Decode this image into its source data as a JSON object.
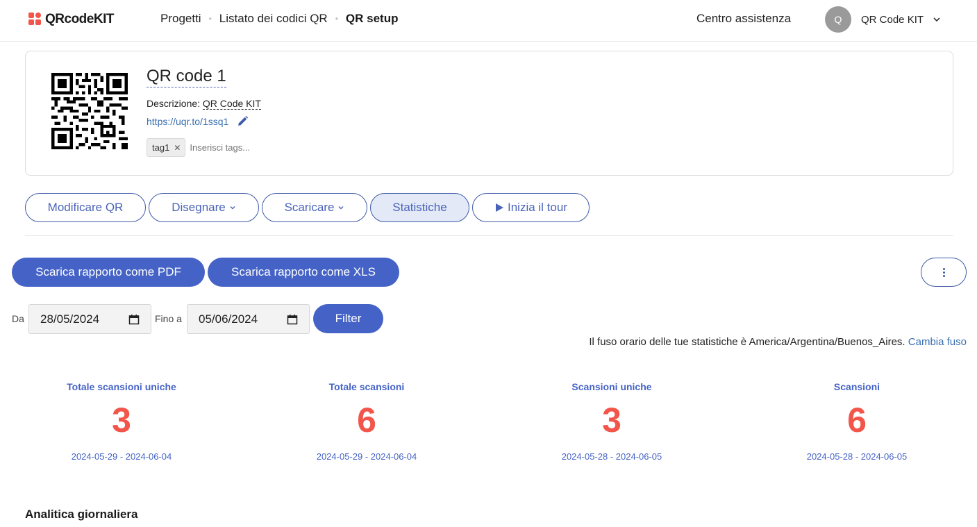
{
  "brand": {
    "name": "QRcodeKIT",
    "accent": "#4563c6",
    "logo_color": "#f2564b"
  },
  "breadcrumb": [
    {
      "label": "Progetti"
    },
    {
      "label": "Listato dei codici QR"
    },
    {
      "label": "QR setup"
    }
  ],
  "header": {
    "help_label": "Centro assistenza",
    "user_initial": "Q",
    "user_name": "QR Code KIT"
  },
  "qr": {
    "title": "QR code 1",
    "description_label": "Descrizione:",
    "description_value": "QR Code KIT",
    "url": "https://uqr.to/1ssq1",
    "tags": [
      "tag1"
    ],
    "tag_placeholder": "Inserisci tags..."
  },
  "tabs": [
    {
      "label": "Modificare QR"
    },
    {
      "label": "Disegnare"
    },
    {
      "label": "Scaricare"
    },
    {
      "label": "Statistiche"
    },
    {
      "label": "Inizia il tour"
    }
  ],
  "reports": {
    "pdf_label": "Scarica rapporto come PDF",
    "xls_label": "Scarica rapporto come XLS"
  },
  "filter": {
    "from_label": "Da",
    "from_value": "28/05/2024",
    "to_label": "Fino a",
    "to_value": "05/06/2024",
    "button_label": "Filter"
  },
  "timezone": {
    "text": "Il fuso orario delle tue statistiche è America/Argentina/Buenos_Aires.",
    "link": "Cambia fuso"
  },
  "stats": [
    {
      "label": "Totale scansioni uniche",
      "value": "3",
      "range": "2024-05-29 - 2024-06-04"
    },
    {
      "label": "Totale scansioni",
      "value": "6",
      "range": "2024-05-29 - 2024-06-04"
    },
    {
      "label": "Scansioni uniche",
      "value": "3",
      "range": "2024-05-28 - 2024-06-05"
    },
    {
      "label": "Scansioni",
      "value": "6",
      "range": "2024-05-28 - 2024-06-05"
    }
  ],
  "section_title": "Analitica giornaliera"
}
